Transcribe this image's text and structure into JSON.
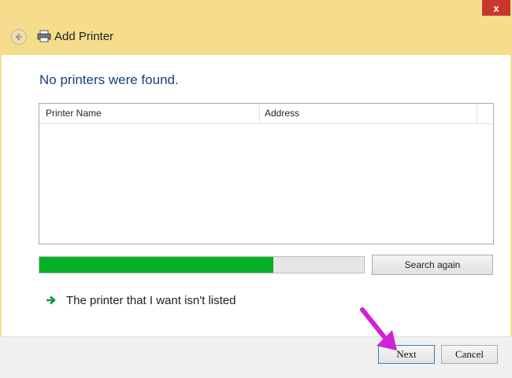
{
  "window": {
    "title": "Add Printer",
    "close_glyph": "x"
  },
  "main": {
    "heading": "No printers were found.",
    "list": {
      "columns": [
        "Printer Name",
        "Address"
      ],
      "rows": []
    },
    "progress": {
      "fraction": 0.72,
      "color": "#06b025"
    },
    "search_again_label": "Search again",
    "not_listed_link": "The printer that I want isn't listed"
  },
  "footer": {
    "next_label": "Next",
    "cancel_label": "Cancel"
  },
  "icons": {
    "back": "back-arrow-icon",
    "printer": "printer-icon",
    "link_arrow": "green-arrow-icon",
    "annotation": "magenta-pointer-arrow"
  },
  "colors": {
    "window_frame": "#f6dd8e",
    "heading": "#1d3e7a",
    "close_button": "#c8372d",
    "annotation_arrow": "#d020d8"
  }
}
